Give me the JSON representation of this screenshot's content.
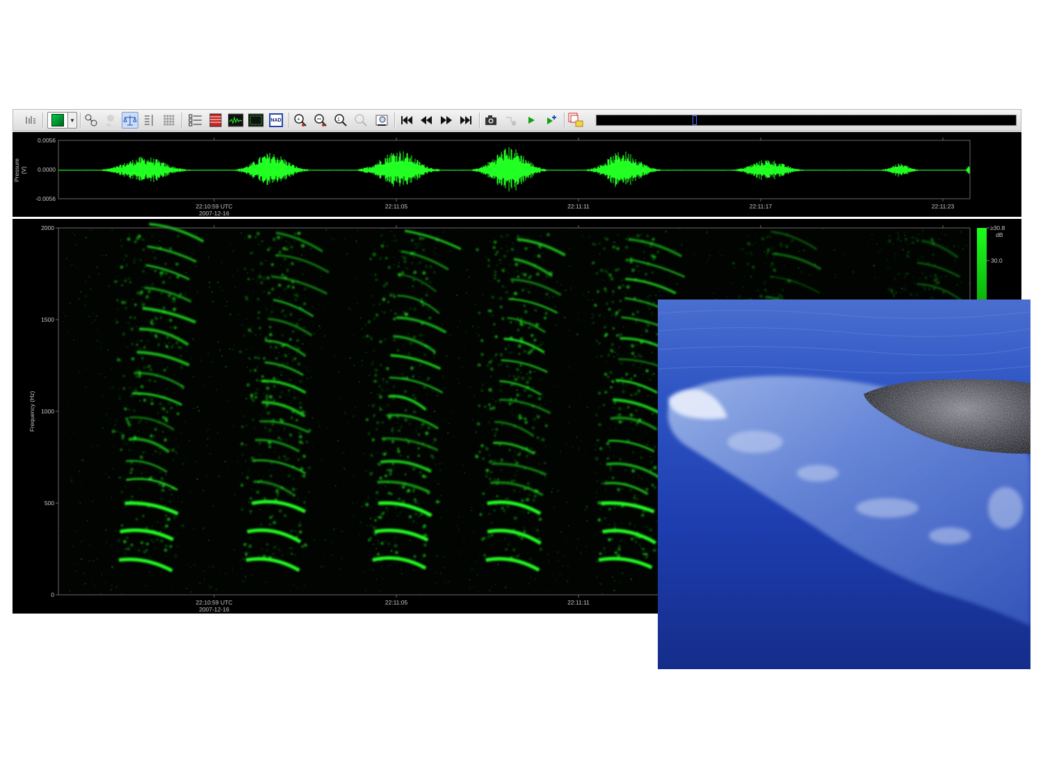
{
  "toolbar": {
    "buttons": [
      {
        "name": "channel-list-button",
        "icon": "bars-icon"
      },
      {
        "name": "colormap-button",
        "icon": "green-square-icon"
      },
      {
        "name": "colormap-dropdown",
        "icon": "chevron-down-icon"
      },
      {
        "name": "link-button",
        "icon": "link-icon"
      },
      {
        "name": "gain-button",
        "icon": "gain-icon"
      },
      {
        "name": "balance-button",
        "icon": "balance-icon"
      },
      {
        "name": "scale-button",
        "icon": "scale-icon"
      },
      {
        "name": "grid-button",
        "icon": "grid-icon"
      },
      {
        "name": "checklist-button",
        "icon": "checklist-icon"
      },
      {
        "name": "table-button",
        "icon": "table-icon"
      },
      {
        "name": "waveform-view-button",
        "icon": "waveform-icon"
      },
      {
        "name": "spectrogram-view-button",
        "icon": "spectrogram-icon"
      },
      {
        "name": "nad-button",
        "icon": "nad-icon",
        "label": "NAD"
      },
      {
        "name": "zoom-in-button",
        "icon": "zoom-in-icon"
      },
      {
        "name": "zoom-out-button",
        "icon": "zoom-out-icon"
      },
      {
        "name": "zoom-fit-button",
        "icon": "zoom-fit-icon"
      },
      {
        "name": "zoom-selection-button",
        "icon": "zoom-selection-icon"
      },
      {
        "name": "zoom-settings-button",
        "icon": "zoom-settings-icon"
      },
      {
        "name": "skip-start-button",
        "icon": "skip-start-icon"
      },
      {
        "name": "rewind-button",
        "icon": "rewind-icon"
      },
      {
        "name": "fast-forward-button",
        "icon": "fast-forward-icon"
      },
      {
        "name": "skip-end-button",
        "icon": "skip-end-icon"
      },
      {
        "name": "snapshot-button",
        "icon": "camera-icon"
      },
      {
        "name": "loop-button",
        "icon": "loop-icon"
      },
      {
        "name": "play-button",
        "icon": "play-icon"
      },
      {
        "name": "play-selection-button",
        "icon": "play-plus-icon"
      },
      {
        "name": "export-button",
        "icon": "export-icon"
      }
    ],
    "navigator_position": 0.23
  },
  "waveform": {
    "ylabel": "Pressure (V)",
    "ylabel_line1": "Pressure",
    "ylabel_line2": "(V)",
    "y_ticks": [
      "0.0056",
      "0.0000",
      "-0.0056"
    ],
    "x_ticks": [
      "22:10:59 UTC",
      "22:11:05",
      "22:11:11",
      "22:11:17",
      "22:11:23"
    ],
    "date_label": "2007-12-16"
  },
  "spectrogram": {
    "ylabel": "Frequency (Hz)",
    "y_ticks": [
      "2000",
      "1500",
      "1000",
      "500",
      "0"
    ],
    "x_ticks": [
      "22:10:59 UTC",
      "22:11:05",
      "22:11:11"
    ],
    "date_label": "2007-12-16",
    "colorbar_max": "≥30.8",
    "colorbar_unit": "dB",
    "colorbar_tick": "30.0"
  },
  "photo": {
    "subject": "whale-photo"
  },
  "colors": {
    "signal": "#22ff22",
    "panel_background": "#000000",
    "water": "#1d3da8"
  }
}
